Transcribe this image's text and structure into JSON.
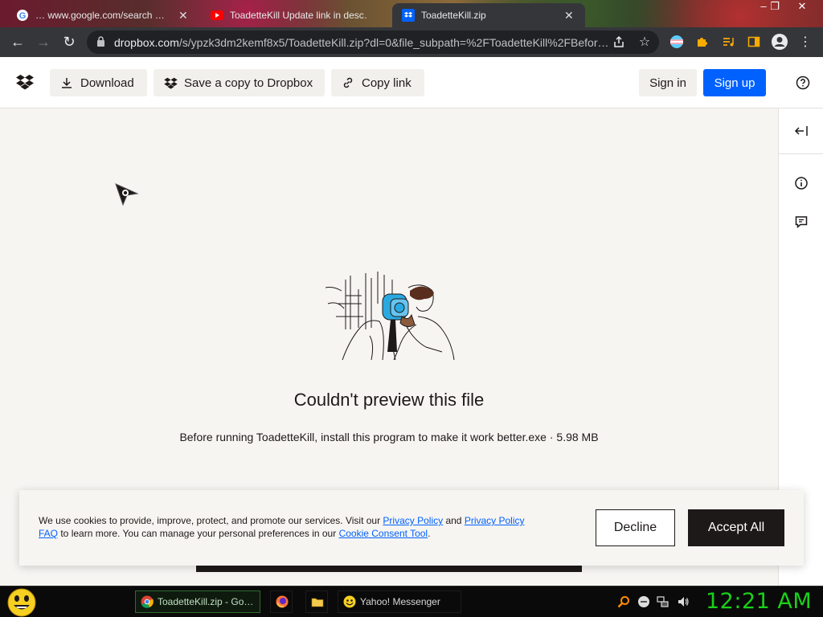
{
  "browser": {
    "tabs": [
      {
        "title": "… www.google.com/search …",
        "icon": "google-icon"
      },
      {
        "title": "ToadetteKill Update link in desc…",
        "icon": "youtube-icon"
      },
      {
        "title": "ToadetteKill.zip",
        "icon": "dropbox-icon",
        "active": true
      }
    ],
    "url_host": "dropbox.com",
    "url_path": "/s/ypzk3dm2kemf8x5/ToadetteKill.zip?dl=0&file_subpath=%2FToadetteKill%2FBefor…",
    "window_controls": [
      "minimize",
      "restore",
      "close"
    ]
  },
  "header": {
    "download_label": "Download",
    "save_label": "Save a copy to Dropbox",
    "copy_link_label": "Copy link",
    "signin_label": "Sign in",
    "signup_label": "Sign up"
  },
  "preview": {
    "title": "Couldn't preview this file",
    "file_description": "Before running ToadetteKill, install this program to make it work better.exe · 5.98 MB"
  },
  "cookie_banner": {
    "text_1": "We use cookies to provide, improve, protect, and promote our services. Visit our ",
    "link_privacy": "Privacy Policy",
    "text_2": " and ",
    "link_privacy_faq_1": "Privacy Policy",
    "link_privacy_faq_2": "FAQ",
    "text_3": " to learn more. You can manage your personal preferences in our ",
    "link_consent": "Cookie Consent Tool",
    "text_4": ".",
    "decline_label": "Decline",
    "accept_label": "Accept All"
  },
  "taskbar": {
    "items": [
      {
        "label": "ToadetteKill.zip - Go…",
        "icon": "chrome-icon"
      },
      {
        "label": "",
        "icon": "firefox-icon"
      },
      {
        "label": "",
        "icon": "folder-icon"
      },
      {
        "label": "Yahoo! Messenger",
        "icon": "yahoo-messenger-icon"
      }
    ],
    "clock": "12:21 AM"
  },
  "colors": {
    "brand_blue": "#0061fe",
    "dropbox_text": "#1e1919",
    "page_bg": "#f7f5f2",
    "clock_green": "#19d119"
  }
}
